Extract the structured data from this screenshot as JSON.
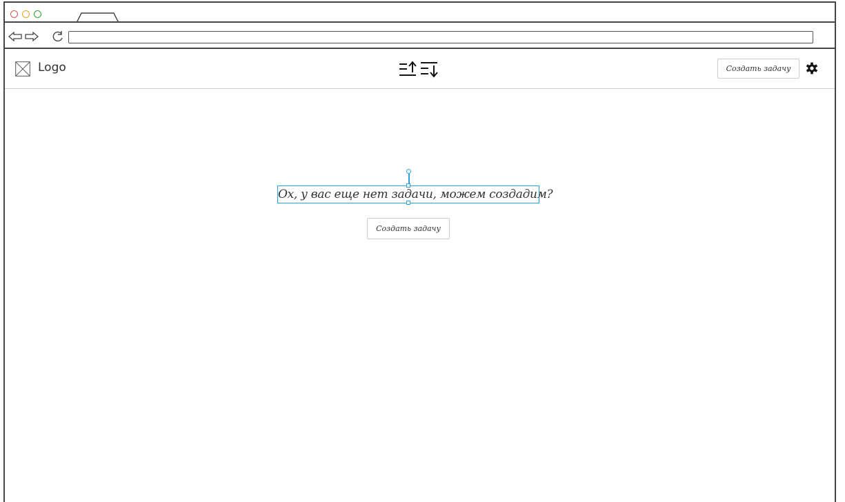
{
  "window": {
    "traffic_lights": [
      "#d9534f",
      "#e8a020",
      "#2aa02a"
    ]
  },
  "addressbar": {
    "back_icon": "arrow-left-icon",
    "forward_icon": "arrow-right-icon",
    "reload_icon": "reload-icon",
    "url": ""
  },
  "header": {
    "logo_text": "Logo",
    "sort_icon_asc": "sort-ascending-icon",
    "sort_icon_desc": "sort-descending-icon",
    "create_task_label": "Создать задачу",
    "settings_icon": "gear-icon"
  },
  "main": {
    "empty_message": "Ох, у вас еще нет задачи, можем создадим?",
    "create_task_label": "Создать задачу",
    "selection_color": "#29a3e0"
  }
}
